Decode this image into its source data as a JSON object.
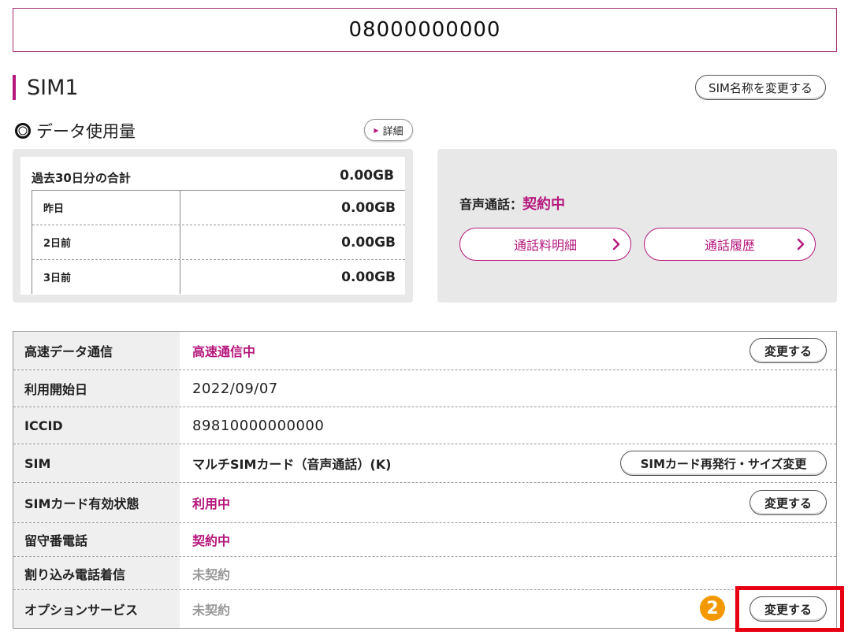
{
  "phone_number": "08000000000",
  "sim_title": "SIM1",
  "rename_button": "SIM名称を変更する",
  "data_usage": {
    "title": "データ使用量",
    "detail_button": "詳細",
    "total_label": "過去30日分の合計",
    "total_value": "0.00GB",
    "rows": [
      {
        "label": "昨日",
        "value": "0.00GB"
      },
      {
        "label": "2日前",
        "value": "0.00GB"
      },
      {
        "label": "3日前",
        "value": "0.00GB"
      }
    ]
  },
  "voice": {
    "label": "音声通話：",
    "status": "契約中",
    "call_details_button": "通話料明細",
    "call_history_button": "通話履歴"
  },
  "info": {
    "high_speed": {
      "label": "高速データ通信",
      "value": "高速通信中",
      "button": "変更する"
    },
    "start_date": {
      "label": "利用開始日",
      "value": "2022/09/07"
    },
    "iccid": {
      "label": "ICCID",
      "value": "89810000000000"
    },
    "sim": {
      "label": "SIM",
      "value": "マルチSIMカード（音声通話）(K)",
      "button": "SIMカード再発行・サイズ変更"
    },
    "sim_status": {
      "label": "SIMカード有効状態",
      "value": "利用中",
      "button": "変更する"
    },
    "voicemail": {
      "label": "留守番電話",
      "value": "契約中"
    },
    "call_waiting": {
      "label": "割り込み電話着信",
      "value": "未契約"
    },
    "options": {
      "label": "オプションサービス",
      "value": "未契約",
      "button": "変更する"
    }
  },
  "step_badge": "2",
  "colors": {
    "accent": "#b5177c",
    "highlight": "#e60012",
    "badge": "#f39800"
  }
}
